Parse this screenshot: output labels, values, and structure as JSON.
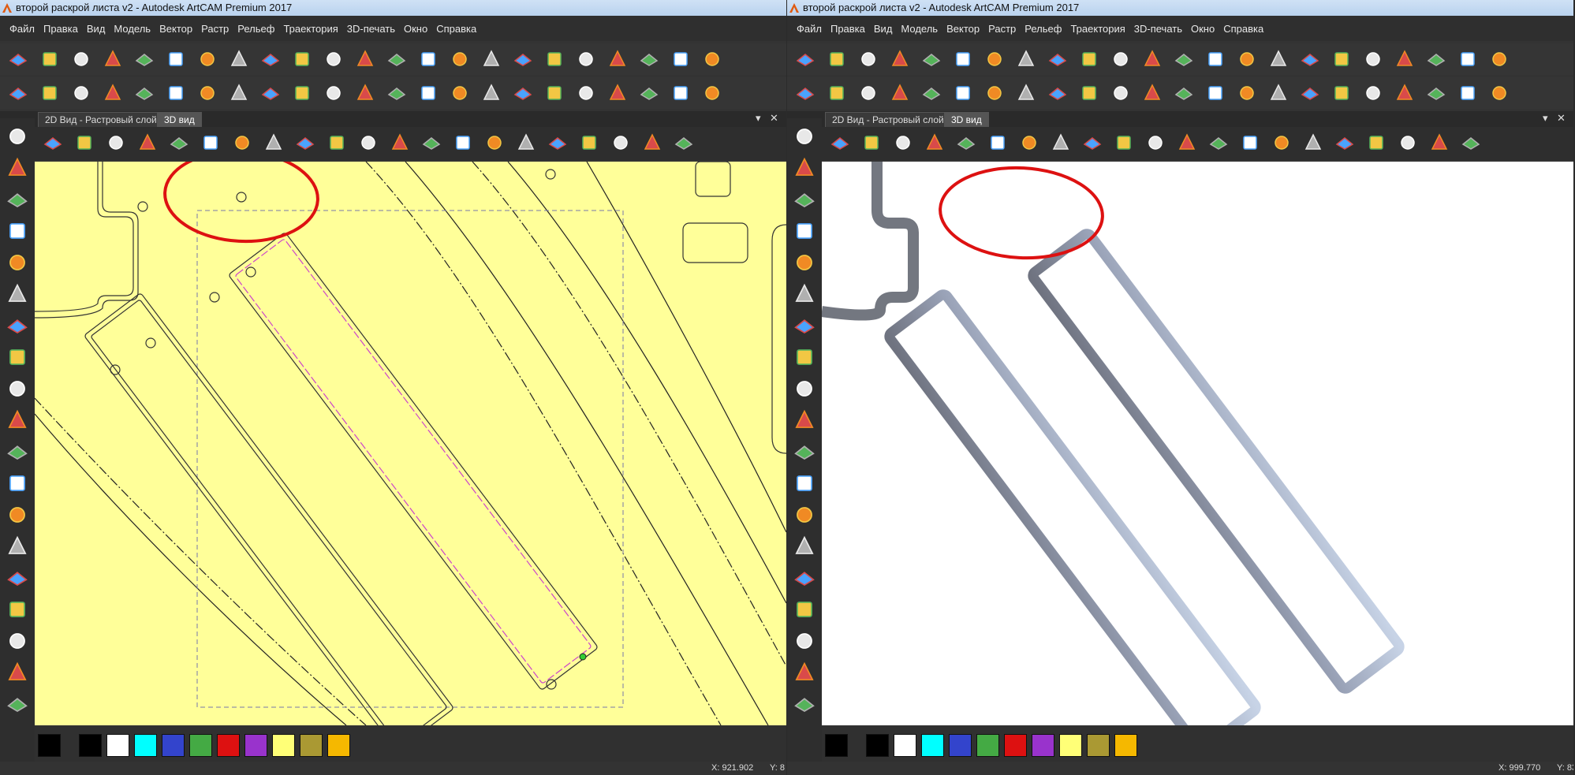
{
  "left_window": {
    "title": "второй раскрой листа v2 - Autodesk ArtCAM Premium 2017",
    "menu": [
      "Файл",
      "Правка",
      "Вид",
      "Модель",
      "Вектор",
      "Растр",
      "Рельеф",
      "Траектория",
      "3D-печать",
      "Окно",
      "Справка"
    ],
    "tabs": [
      {
        "label": "2D Вид - Растровый слой",
        "active": false
      },
      {
        "label": "3D вид",
        "active": true
      }
    ],
    "tab_controls": {
      "dropdown": "▾",
      "close": "✕"
    },
    "canvas": {
      "background": "#ffff99"
    },
    "status": {
      "x": "X: 921.902",
      "y": "Y: 8"
    }
  },
  "right_window": {
    "title": "второй раскрой листа v2 - Autodesk ArtCAM Premium 2017",
    "menu": [
      "Файл",
      "Правка",
      "Вид",
      "Модель",
      "Вектор",
      "Растр",
      "Рельеф",
      "Траектория",
      "3D-печать",
      "Окно",
      "Справка"
    ],
    "tabs": [
      {
        "label": "2D Вид - Растровый слой",
        "active": false
      },
      {
        "label": "3D вид",
        "active": true
      }
    ],
    "tab_controls": {
      "dropdown": "▾",
      "close": "✕"
    },
    "canvas": {
      "background": "#ffffff"
    },
    "status": {
      "x": "X: 999.770",
      "y": "Y: 83"
    }
  },
  "palette_colors": [
    "#000000",
    "#ffffff",
    "#00ffff",
    "#3344cc",
    "#44aa44",
    "#dd1111",
    "#9933cc",
    "#ffff77",
    "#aa9933",
    "#f5b800"
  ],
  "highlight_color": "#dd1111",
  "toolbar_icons_row1": [
    "new-file-icon",
    "open-folder-icon",
    "save-icon",
    "cut-icon",
    "copy-icon",
    "paste-icon",
    "undo-icon",
    "redo-icon",
    "notes-icon",
    "set-model-size-icon",
    "job-setup-icon",
    "grid-icon",
    "hammer-icon",
    "3d-glasses-icon",
    "paint-tool-icon",
    "layers-icon",
    "color-select-icon",
    "import-folder-icon",
    "vector-join-icon",
    "node-edit-icon",
    "curve-icon",
    "relief-layer-icon",
    "bitmap-icon"
  ],
  "toolbar_icons_row2": [
    "zoom-fit-icon",
    "rotate-view-icon",
    "relief-shape-icon",
    "eraser-icon",
    "extrude-icon",
    "spin-icon",
    "texture-icon",
    "relief-flat-icon",
    "relief-star-icon",
    "relief-offset-icon",
    "relief-sweep-icon",
    "relief-stack-icon",
    "relief-bevel-icon",
    "relief-smooth-icon",
    "relief-raise-icon",
    "relief-lower-icon",
    "relief-bulb-icon",
    "relief-cut-icon",
    "relief-sheet-icon",
    "relief-dome-icon",
    "relief-plane-icon",
    "relief-cube-icon",
    "relief-layers-icon"
  ],
  "view_icons": [
    "iso-view-icon",
    "front-view-icon",
    "side-view-icon",
    "top-view-icon",
    "zoom-icon",
    "light-bulb-icon",
    "shaded-icon",
    "axes-icon",
    "puzzle-icon",
    "cylinder-icon",
    "plate-icon",
    "section-icon",
    "timer-icon",
    "star-view-icon",
    "blue-plane-icon",
    "red-plane-icon",
    "gold-plate-icon",
    "green-shapes-icon",
    "search-star-icon",
    "layer-stack-icon",
    "rainbow-stack-icon"
  ],
  "left_tool_icons": [
    "select-icon",
    "node-select-icon",
    "transform-icon",
    "grid-tool-icon",
    "pencil-icon",
    "eraser-tool-icon",
    "measure-icon",
    "polyline-icon",
    "rectangle-icon",
    "circle-icon",
    "polygon-icon",
    "arc-icon",
    "text-tool-icon",
    "drop-icon",
    "fill-hand-icon",
    "brush-icon",
    "marker-icon",
    "rubber-icon",
    "paint-bucket-icon"
  ]
}
